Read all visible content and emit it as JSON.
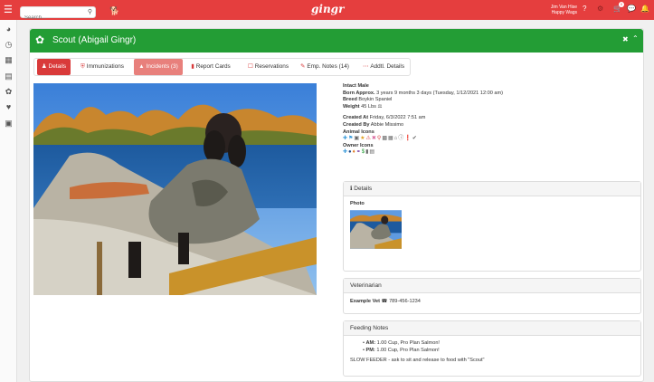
{
  "topbar": {
    "search_placeholder": "Search...",
    "logo": "gingr",
    "user_name": "Jim Van Hise",
    "user_org": "Happy Wags",
    "cart_count": "0",
    "colors": {
      "bar": "#e53e3e"
    }
  },
  "sidebar": {
    "items": [
      "dashboard-icon",
      "clock-icon",
      "calendar-icon",
      "id-card-icon",
      "paw-icon",
      "heart-icon",
      "book-icon"
    ]
  },
  "panel": {
    "title": "Scout (Abigail Gingr)",
    "header_color": "#239d35",
    "tabs": [
      {
        "label": "Details",
        "active": true
      },
      {
        "label": "Immunizations"
      },
      {
        "label": "Incidents (3)",
        "warn": true
      },
      {
        "label": "Report Cards"
      },
      {
        "label": "Reservations"
      },
      {
        "label": "Emp. Notes (14)"
      },
      {
        "label": "Addtl. Details"
      }
    ]
  },
  "pet": {
    "sex": "Intact Male",
    "born_label": "Born Approx.",
    "born_value": "3 years 9 months 3 days (Tuesday, 1/12/2021 12:00 am)",
    "breed_label": "Breed",
    "breed_value": "Boykin Spaniel",
    "weight_label": "Weight",
    "weight_value": "45 Lbs",
    "created_at_label": "Created At",
    "created_at_value": "Friday, 6/3/2022 7:51 am",
    "created_by_label": "Created By",
    "created_by_value": "Abbie Missimo",
    "animal_icons_label": "Animal Icons",
    "owner_icons_label": "Owner Icons"
  },
  "details_card": {
    "title": "Details",
    "photo_label": "Photo"
  },
  "vet_card": {
    "title": "Veterinarian",
    "name": "Example Vet",
    "phone": "789-456-1234"
  },
  "feeding_card": {
    "title": "Feeding Notes",
    "am_label": "AM:",
    "am_value": "1.00 Cup, Pro Plan Salmon!",
    "pm_label": "PM:",
    "pm_value": "1.00 Cup, Pro Plan Salmon!",
    "note": "SLOW FEEDER - ask to sit and release to food with \"Scout\""
  }
}
